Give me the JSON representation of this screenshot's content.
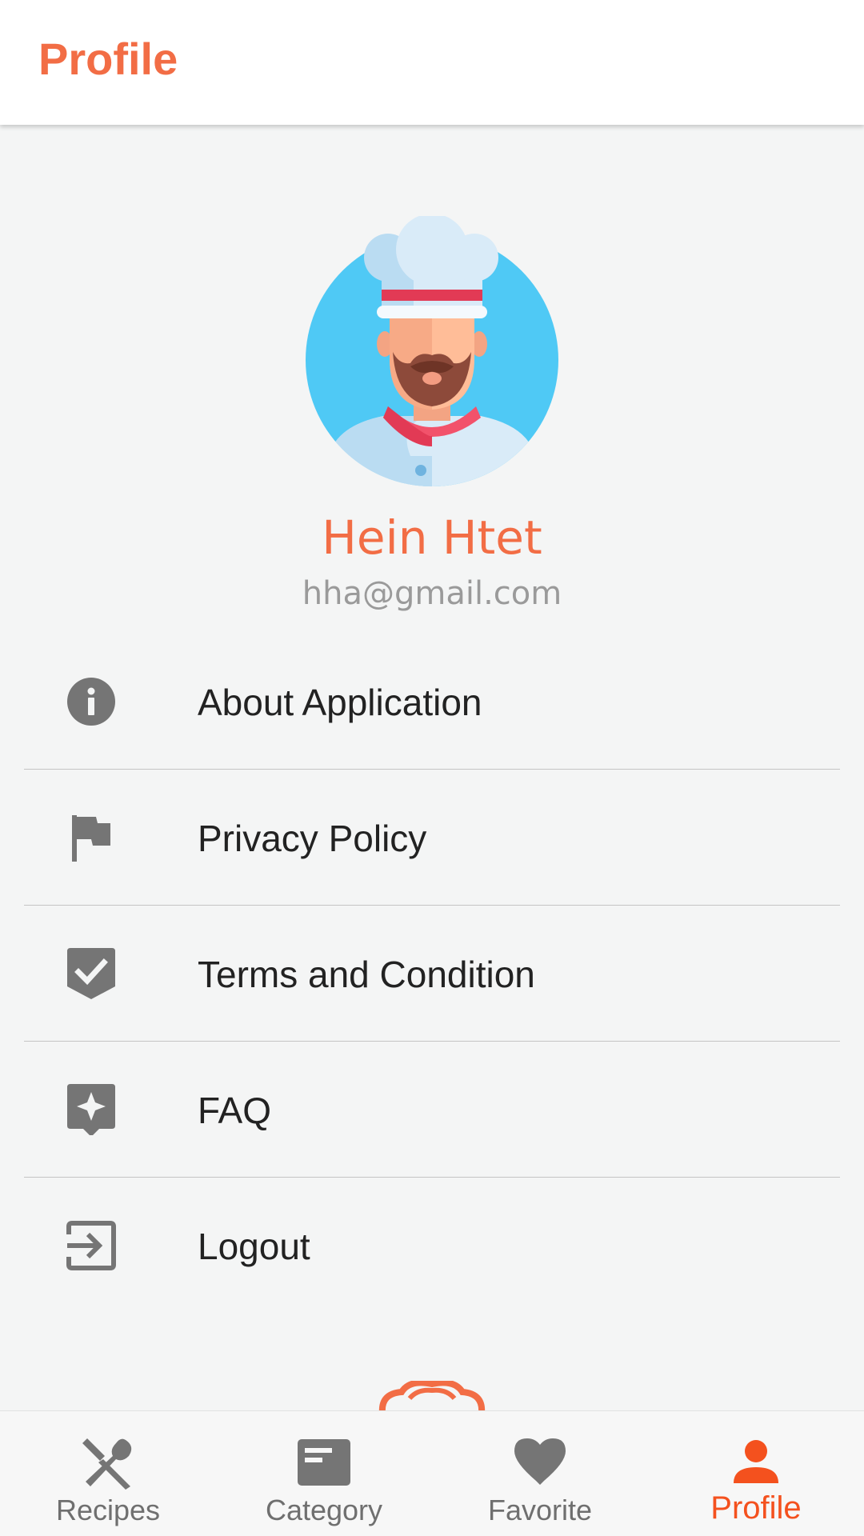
{
  "app_bar": {
    "title": "Profile"
  },
  "profile": {
    "avatar_icon": "chef-avatar-icon",
    "name": "Hein Htet",
    "email": "hha@gmail.com"
  },
  "menu": {
    "items": [
      {
        "label": "About Application",
        "icon": "info-icon"
      },
      {
        "label": "Privacy Policy",
        "icon": "flag-icon"
      },
      {
        "label": "Terms and Condition",
        "icon": "shield-check-icon"
      },
      {
        "label": "FAQ",
        "icon": "feedback-star-icon"
      },
      {
        "label": "Logout",
        "icon": "logout-icon"
      }
    ]
  },
  "bottom_nav": {
    "items": [
      {
        "label": "Recipes",
        "icon": "utensils-icon"
      },
      {
        "label": "Category",
        "icon": "category-card-icon"
      },
      {
        "label": "Favorite",
        "icon": "heart-icon"
      },
      {
        "label": "Profile",
        "icon": "person-icon"
      }
    ],
    "active": "Profile"
  },
  "colors": {
    "accent": "#f26d45",
    "active_nav": "#f4511e",
    "icon_gray": "#757575",
    "background": "#f4f5f5"
  }
}
